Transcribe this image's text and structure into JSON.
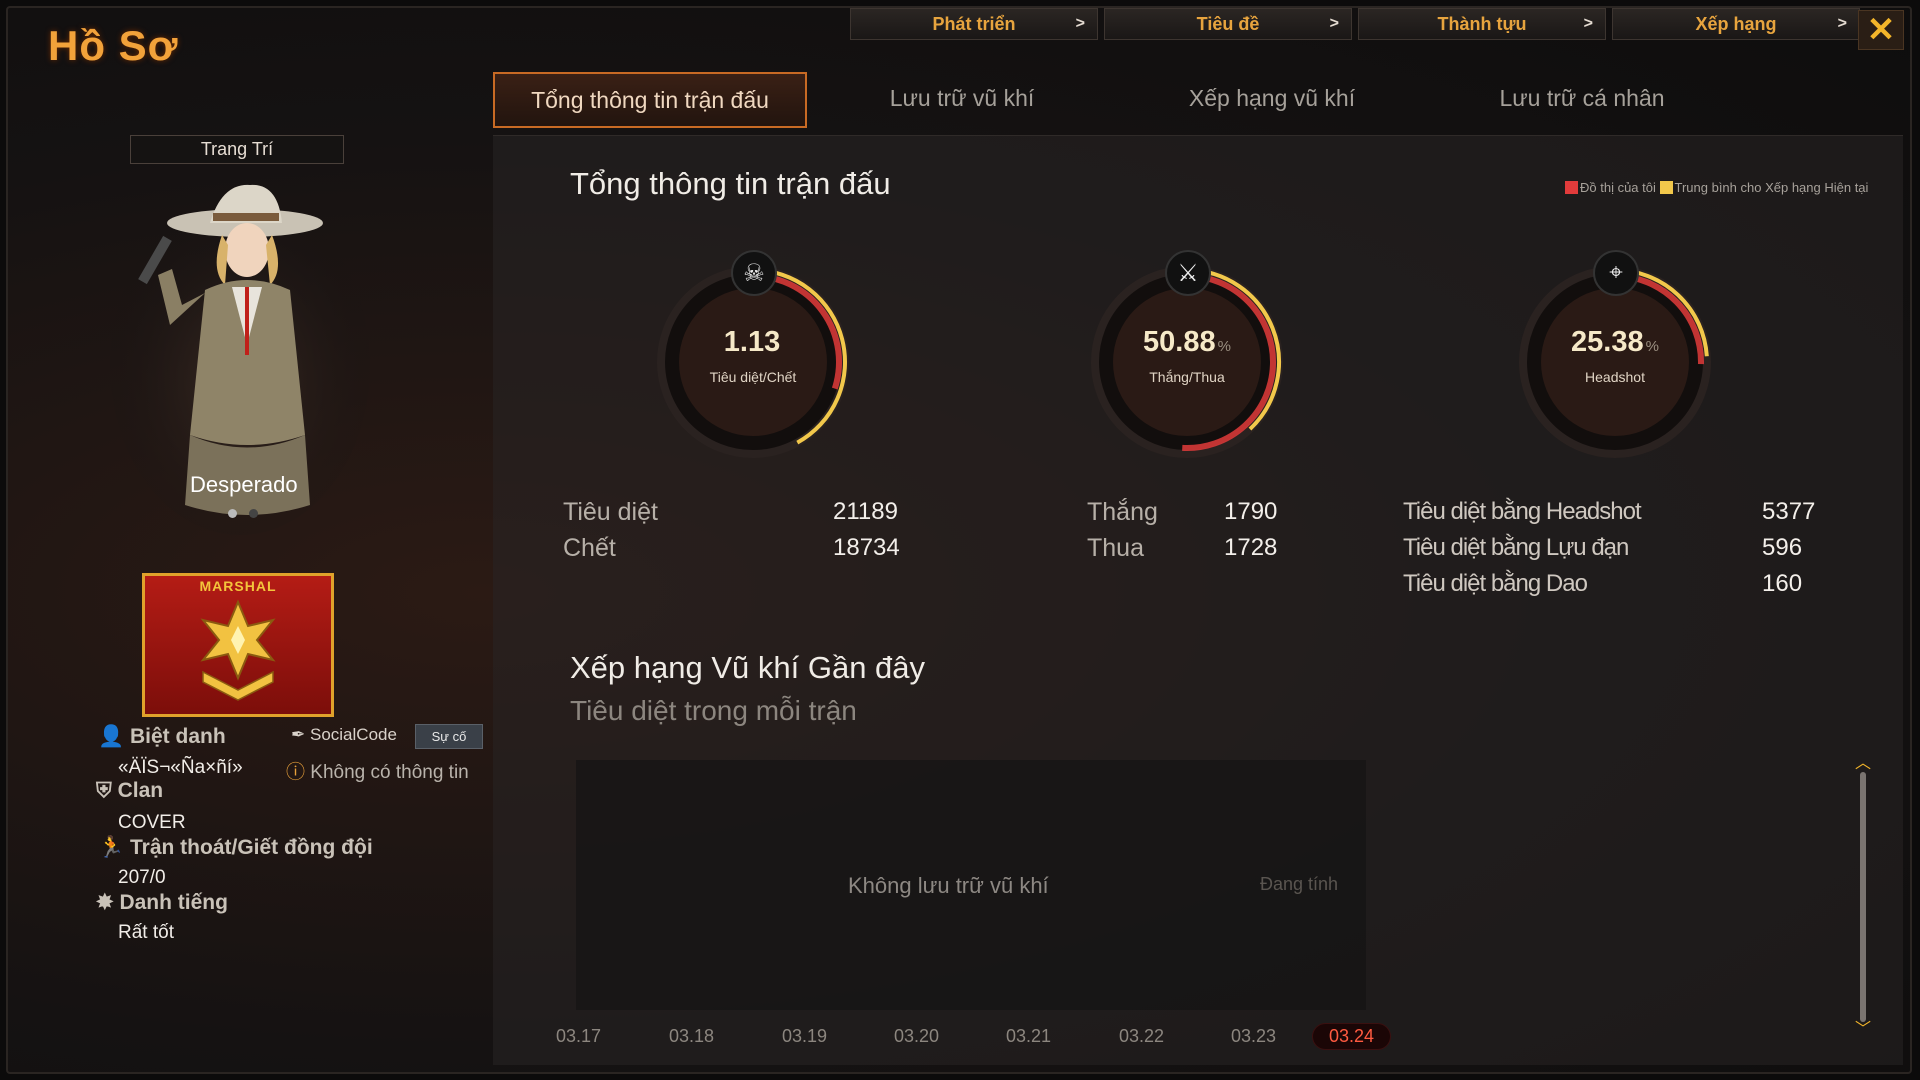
{
  "app_title": "Hồ Sơ",
  "top_nav": [
    {
      "label": "Phát triển",
      "arrow": ">"
    },
    {
      "label": "Tiêu đề",
      "arrow": ">"
    },
    {
      "label": "Thành tựu",
      "arrow": ">"
    },
    {
      "label": "Xếp hạng",
      "arrow": ">"
    }
  ],
  "close_label": "✕",
  "tabs": [
    {
      "label": "Tổng thông tin trận đấu",
      "active": true
    },
    {
      "label": "Lưu trữ vũ khí",
      "active": false
    },
    {
      "label": "Xếp hạng vũ khí",
      "active": false
    },
    {
      "label": "Lưu trữ cá nhân",
      "active": false
    }
  ],
  "left": {
    "decorate_button": "Trang Trí",
    "character_name": "Desperado",
    "rank_title": "MARSHAL",
    "nickname_label": "Biệt danh",
    "nickname_value": "«ÄÏS¬«Ña×ñí»",
    "social_code_label": "SocialCode",
    "social_code_button": "Sự cố",
    "social_code_value": "Không có thông tin",
    "clan_label": "Clan",
    "clan_value": "COVER",
    "escape_label": "Trận thoát/Giết đồng đội",
    "escape_value": "207/0",
    "reputation_label": "Danh tiếng",
    "reputation_value": "Rất tốt"
  },
  "summary": {
    "title": "Tổng thông tin trận đấu",
    "legend_mine": "Đồ thị của tôi",
    "legend_avg": "Trung bình cho Xếp hạng Hiện tại",
    "colors": {
      "mine": "#e23b3b",
      "avg": "#f2c84b"
    },
    "gauges": [
      {
        "value": "1.13",
        "unit": "",
        "label": "Tiêu diệt/Chết",
        "icon": "skull-icon",
        "fill_mine": 0.3,
        "fill_avg": 0.42
      },
      {
        "value": "50.88",
        "unit": "%",
        "label": "Thắng/Thua",
        "icon": "crossed-swords-icon",
        "fill_mine": 0.5088,
        "fill_avg": 0.38
      },
      {
        "value": "25.38",
        "unit": "%",
        "label": "Headshot",
        "icon": "crosshair-gun-icon",
        "fill_mine": 0.2538,
        "fill_avg": 0.24
      }
    ],
    "stats_kd": [
      {
        "label": "Tiêu diệt",
        "value": "21189"
      },
      {
        "label": "Chết",
        "value": "18734"
      }
    ],
    "stats_wl": [
      {
        "label": "Thắng",
        "value": "1790"
      },
      {
        "label": "Thua",
        "value": "1728"
      }
    ],
    "stats_hs": [
      {
        "label": "Tiêu diệt bằng Headshot",
        "value": "5377"
      },
      {
        "label": "Tiêu diệt bằng Lựu đạn",
        "value": "596"
      },
      {
        "label": "Tiêu diệt bằng Dao",
        "value": "160"
      }
    ]
  },
  "weapon_rank": {
    "title": "Xếp hạng Vũ khí Gần đây",
    "subtitle": "Tiêu diệt trong mỗi trận",
    "empty_text": "Không lưu trữ vũ khí",
    "status_text": "Đang tính",
    "dates": [
      "03.17",
      "03.18",
      "03.19",
      "03.20",
      "03.21",
      "03.22",
      "03.23",
      "03.24"
    ],
    "selected_date": "03.24"
  }
}
